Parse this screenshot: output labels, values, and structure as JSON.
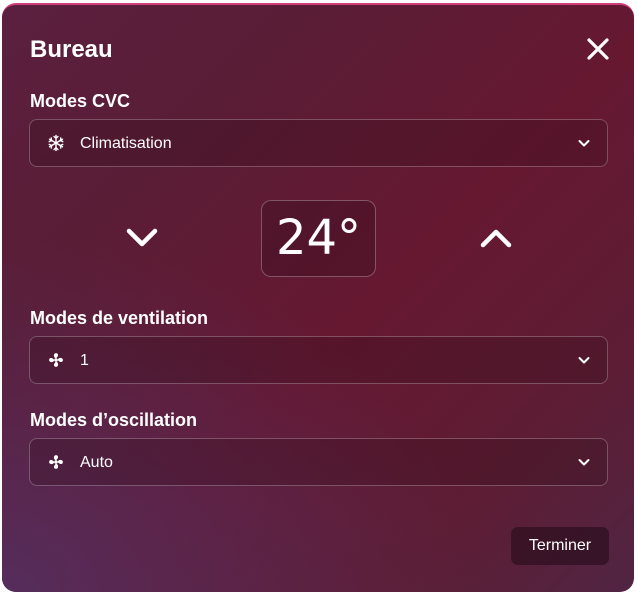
{
  "dialog": {
    "title": "Bureau",
    "close_icon": "close-icon"
  },
  "hvac": {
    "label": "Modes CVC",
    "selected": "Climatisation",
    "icon": "snowflake-icon"
  },
  "temperature": {
    "value": "24°",
    "decrease_icon": "chevron-down-icon",
    "increase_icon": "chevron-up-icon"
  },
  "fan": {
    "label": "Modes de ventilation",
    "selected": "1",
    "icon": "fan-icon"
  },
  "swing": {
    "label": "Modes d’oscillation",
    "selected": "Auto",
    "icon": "fan-icon"
  },
  "footer": {
    "done_label": "Terminer"
  },
  "colors": {
    "accent_border": "#d23e79",
    "text": "#ffffff"
  }
}
